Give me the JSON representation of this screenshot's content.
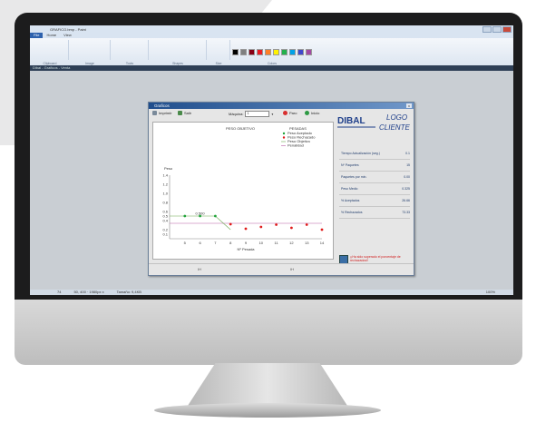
{
  "app": {
    "window_title": "GRAFICO.bmp - Paint",
    "menu": [
      "File",
      "Home",
      "View"
    ],
    "ribbon_groups": [
      "Clipboard",
      "Image",
      "Tools",
      "Shapes",
      "Size",
      "Colors"
    ],
    "palette": [
      "#000000",
      "#7f7f7f",
      "#880015",
      "#ed1c24",
      "#ff7f27",
      "#fff200",
      "#22b14c",
      "#00a2e8",
      "#3f48cc",
      "#a349a4",
      "#ffffff",
      "#c3c3c3"
    ],
    "app_bar": [
      "Dibal - Graficos - Venta"
    ],
    "status": [
      "74",
      "50, 400 · 1980px x",
      "Tamaño: 9,4KB",
      "100%"
    ]
  },
  "dialog": {
    "title": "Graficos",
    "toolbar": {
      "print": "Imprimir",
      "exit": "Salir",
      "machine_label": "Máquina:",
      "machine_value": "1",
      "stop": "Paro",
      "start": "Inicio"
    },
    "logos": {
      "dibal": "DIBAL",
      "cliente_line1": "LOGO",
      "cliente_line2": "CLIENTE"
    },
    "stats": [
      {
        "label": "Tiempo Actualización (seg.)",
        "value": "0.1"
      },
      {
        "label": "Nº Paquetes",
        "value": "15"
      },
      {
        "label": "Paquetes por min.",
        "value": "0.00"
      },
      {
        "label": "Peso Medio",
        "value": "0.325"
      },
      {
        "label": "% Aceptados",
        "value": "26.66"
      },
      {
        "label": "% Rechazados",
        "value": "73.33"
      }
    ],
    "warning": "¡¡Ha sido superado el porcentaje de rechazados!!",
    "footer": [
      "IH",
      "IH"
    ]
  },
  "chart_data": {
    "type": "scatter",
    "title": "PESO OBJETIVO",
    "subtitle": "PESADAS",
    "annotation": "0.500",
    "xlabel": "Nº Pesada",
    "ylabel": "Peso",
    "xlim": [
      4,
      14
    ],
    "ylim": [
      0,
      1.4
    ],
    "x_ticks": [
      5,
      6,
      7,
      8,
      9,
      10,
      11,
      12,
      13,
      14
    ],
    "y_ticks": [
      "0.1",
      "0.2",
      "0.4",
      "0.5",
      "0.6",
      "0.8",
      "1.0",
      "1.2",
      "1.4"
    ],
    "legend": [
      "Peso Aceptado",
      "Peso Rechazado",
      "Peso Objetivo",
      "Penalidad"
    ],
    "series": [
      {
        "name": "Peso Aceptado",
        "color": "#1fa33a",
        "points": [
          [
            5,
            0.5
          ],
          [
            6,
            0.5
          ],
          [
            7,
            0.5
          ]
        ]
      },
      {
        "name": "Peso Rechazado",
        "color": "#e01b1b",
        "points": [
          [
            8,
            0.32
          ],
          [
            9,
            0.22
          ],
          [
            10,
            0.26
          ],
          [
            11,
            0.31
          ],
          [
            12,
            0.24
          ],
          [
            13,
            0.31
          ],
          [
            14,
            0.2
          ]
        ]
      },
      {
        "name": "Peso Objetivo",
        "color": "#6aa84f",
        "points": [
          [
            4,
            0.5
          ],
          [
            7,
            0.5
          ],
          [
            8,
            0.2
          ]
        ]
      },
      {
        "name": "Penalidad",
        "color": "#b75da3",
        "points": [
          [
            4,
            0.34
          ],
          [
            14,
            0.34
          ]
        ]
      }
    ]
  }
}
